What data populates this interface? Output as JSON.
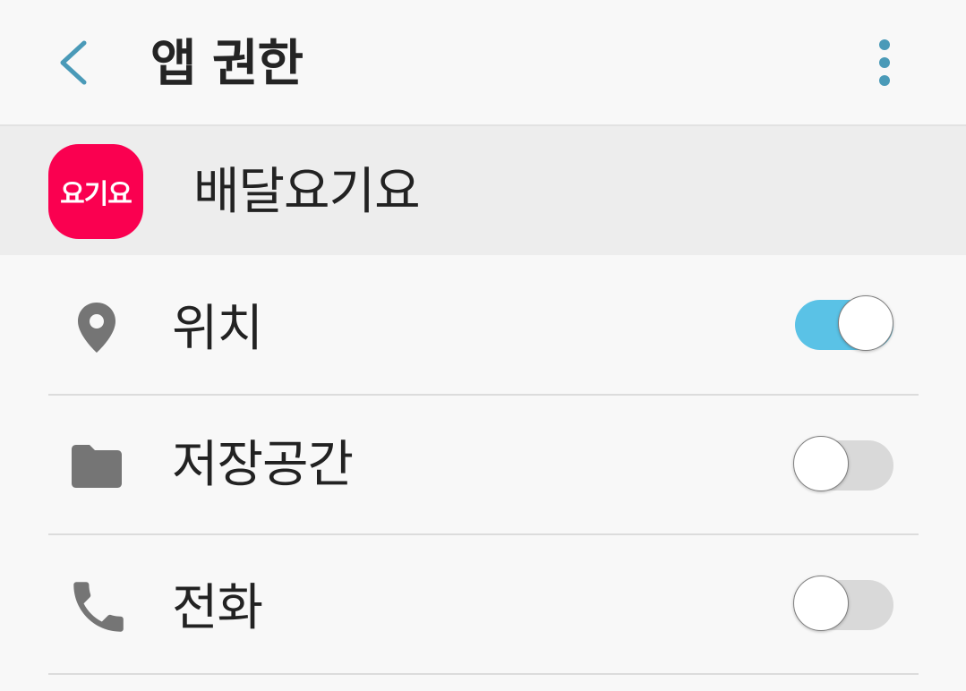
{
  "toolbar": {
    "title": "앱 권한",
    "back_icon": "chevron-left-icon",
    "more_icon": "more-vert-icon",
    "accent_color": "#4a9ab8"
  },
  "app": {
    "name": "배달요기요",
    "icon_text": "요기요",
    "icon_color": "#fa0050"
  },
  "permissions": [
    {
      "label": "위치",
      "icon": "location-pin-icon",
      "enabled": true
    },
    {
      "label": "저장공간",
      "icon": "folder-icon",
      "enabled": false
    },
    {
      "label": "전화",
      "icon": "phone-icon",
      "enabled": false
    }
  ],
  "colors": {
    "toggle_on": "#5ac2e6",
    "toggle_off": "#d9d9d9",
    "icon_gray": "#757575"
  }
}
